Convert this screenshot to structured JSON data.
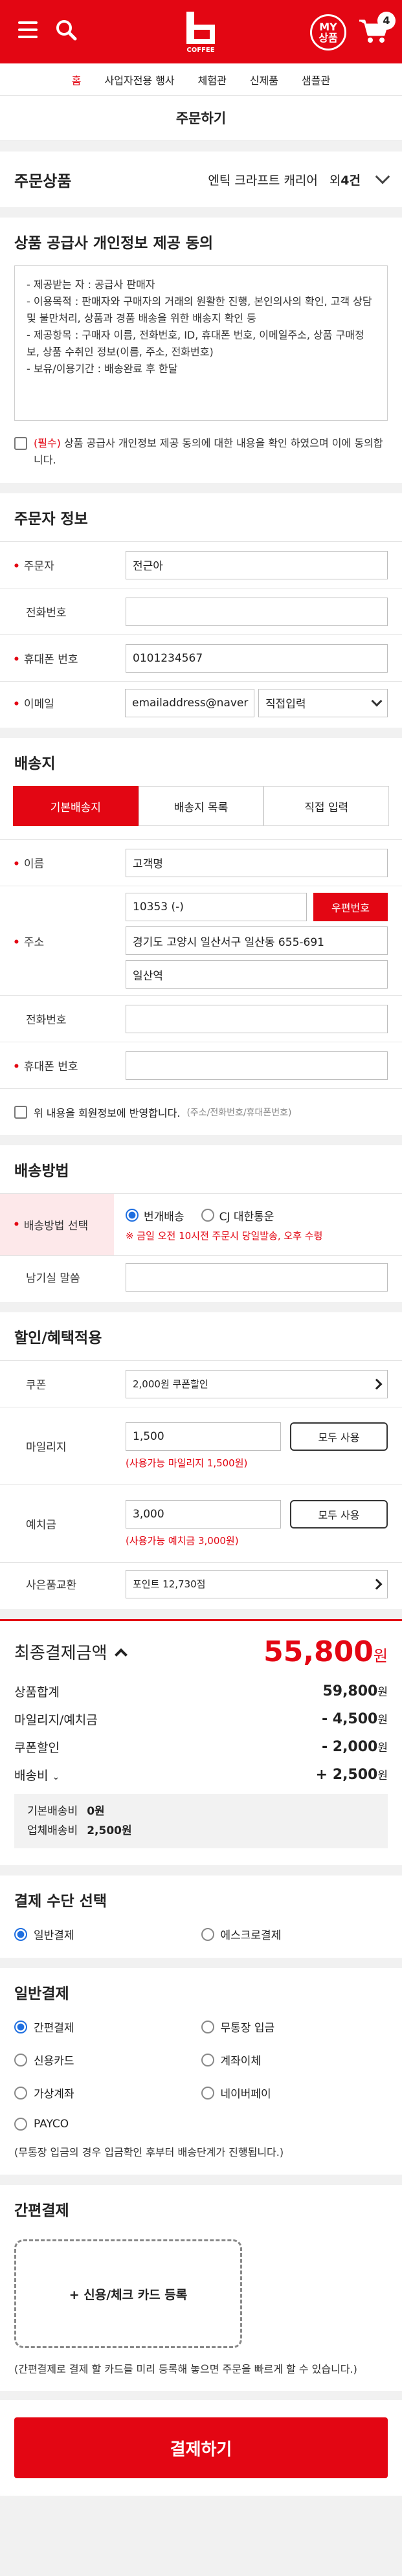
{
  "header": {
    "my_line1": "MY",
    "my_line2": "상품",
    "cart_count": "4"
  },
  "nav": [
    "홈",
    "사업자전용 행사",
    "체험관",
    "신제품",
    "샘플관"
  ],
  "page_title": "주문하기",
  "order_items": {
    "title": "주문상품",
    "product": "엔틱 크라프트 캐리어",
    "count_prefix": "외",
    "count": "4건"
  },
  "consent": {
    "title": "상품 공급사 개인정보 제공 동의",
    "lines": [
      "- 제공받는 자 : 공급사 판매자",
      "- 이용목적 : 판매자와 구매자의 거래의 원활한 진행, 본인의사의 확인, 고객 상담 및 불만처리, 상품과 경품 배송을 위한 배송지 확인 등",
      "- 제공항목 : 구매자 이름, 전화번호, ID, 휴대폰 번호, 이메일주소, 상품 구매정보, 상품 수취인 정보(이름, 주소, 전화번호)",
      "- 보유/이용기간 : 배송완료 후 한달"
    ],
    "check_required": "(필수)",
    "check_text": "상품 공급사 개인정보 제공 동의에 대한 내용을 확인 하였으며 이에 동의합니다."
  },
  "orderer": {
    "title": "주문자 정보",
    "name_label": "주문자",
    "name_value": "전근아",
    "phone_label": "전화번호",
    "phone_value": "",
    "mobile_label": "휴대폰 번호",
    "mobile_value": "0101234567",
    "email_label": "이메일",
    "email_value": "emailaddress@naver",
    "email_domain": "직접입력"
  },
  "shipping": {
    "title": "배송지",
    "tabs": [
      "기본배송지",
      "배송지 목록",
      "직접 입력"
    ],
    "name_label": "이름",
    "name_value": "고객명",
    "addr_label": "주소",
    "zip": "10353 (-)",
    "zip_button": "우편번호",
    "addr1": "경기도 고양시 일산서구 일산동 655-691",
    "addr2": "일산역",
    "phone_label": "전화번호",
    "mobile_label": "휴대폰 번호",
    "reflect_text": "위 내용을 회원정보에 반영합니다.",
    "reflect_hint": "(주소/전화번호/휴대폰번호)"
  },
  "delivery": {
    "title": "배송방법",
    "select_label": "배송방법 선택",
    "opt1": "번개배송",
    "opt2": "CJ 대한통운",
    "notice": "※ 금일 오전 10시전 주문시 당일발송, 오후 수령",
    "message_label": "남기실 말씀"
  },
  "discount": {
    "title": "할인/혜택적용",
    "coupon_label": "쿠폰",
    "coupon_value": "2,000원 쿠폰할인",
    "mileage_label": "마일리지",
    "mileage_value": "1,500",
    "mileage_button": "모두 사용",
    "mileage_note": "(사용가능 마일리지 1,500원)",
    "deposit_label": "예치금",
    "deposit_value": "3,000",
    "deposit_button": "모두 사용",
    "deposit_note": "(사용가능 예치금 3,000원)",
    "gift_label": "사은품교환",
    "gift_value": "포인트 12,730점"
  },
  "summary": {
    "title": "최종결제금액",
    "total": "55,800",
    "won": "원",
    "product_total_label": "상품합계",
    "product_total": "59,800",
    "mileage_label": "마일리지/예치금",
    "mileage": "- 4,500",
    "coupon_label": "쿠폰할인",
    "coupon": "- 2,000",
    "shipping_label": "배송비",
    "shipping": "+ 2,500",
    "base_ship_label": "기본배송비",
    "base_ship": "0원",
    "vendor_ship_label": "업체배송비",
    "vendor_ship": "2,500원"
  },
  "pay_method": {
    "title": "결제 수단 선택",
    "opt1": "일반결제",
    "opt2": "에스크로결제"
  },
  "general_pay": {
    "title": "일반결제",
    "options": [
      "간편결제",
      "무통장 입금",
      "신용카드",
      "계좌이체",
      "가상계좌",
      "네이버페이",
      "PAYCO"
    ],
    "note": "(무통장 입금의 경우 입금확인 후부터 배송단계가 진행됩니다.)"
  },
  "easy_pay": {
    "title": "간편결제",
    "add_card": "+ 신용/체크 카드 등록",
    "note": "(간편결제로 결제 할 카드를 미리 등록해 놓으면 주문을 빠르게 할 수 있습니다.)"
  },
  "pay_button": "결제하기",
  "colors": {
    "brand": "#e30613",
    "radio": "#1f6fe0"
  }
}
